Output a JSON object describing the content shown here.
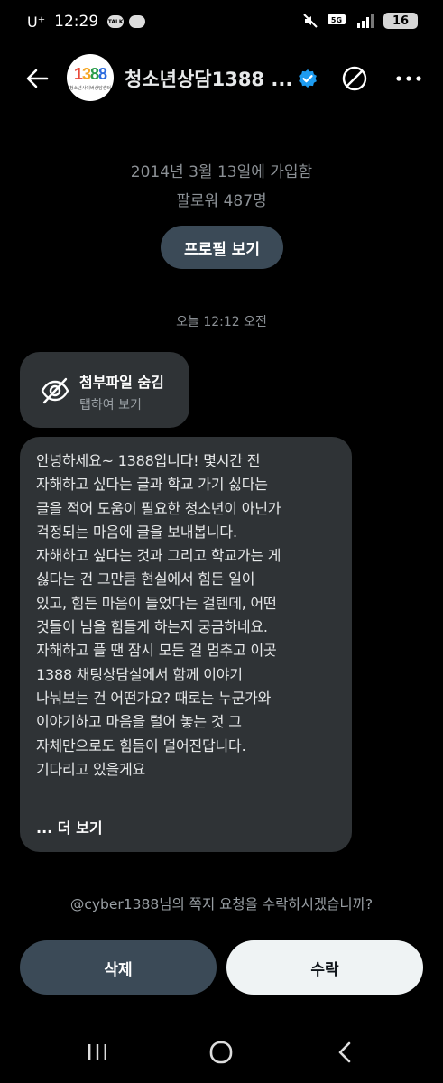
{
  "status_bar": {
    "carrier": "U⁺",
    "time": "12:29",
    "battery": "16"
  },
  "header": {
    "avatar_text": "1388",
    "avatar_subtext": "청소년사이버상담센터",
    "title": "청소년상담1388 ..."
  },
  "profile_info": {
    "joined": "2014년 3월 13일에 가입함",
    "followers": "팔로워 487명",
    "profile_button": "프로필 보기"
  },
  "conversation": {
    "timestamp": "오늘 12:12 오전",
    "attachment": {
      "title": "첨부파일 숨김",
      "subtitle": "탭하여 보기"
    },
    "message": {
      "text": "안녕하세요~ 1388입니다! 몇시간 전\n자해하고 싶다는 글과 학교 가기 싫다는\n글을 적어 도움이 필요한 청소년이 아닌가\n걱정되는 마음에 글을 보내봅니다.\n자해하고 싶다는 것과 그리고 학교가는 게\n싫다는 건 그만큼 현실에서 힘든 일이\n있고, 힘든 마음이 들었다는 걸텐데, 어떤\n것들이 님을 힘들게 하는지 궁금하네요.\n자해하고 플 땐 잠시 모든 걸 멈추고 이곳\n1388 채팅상담실에서 함께 이야기\n나눠보는 건 어떤가요?  때로는 누군가와\n이야기하고 마음을 털어 놓는 것 그\n자체만으로도 힘듬이 덜어진답니다.\n기다리고 있을게요",
      "more_label": "... 더 보기"
    }
  },
  "request": {
    "prompt": "@cyber1388님의 쪽지 요청을 수락하시겠습니까?",
    "delete_label": "삭제",
    "accept_label": "수락"
  },
  "colors": {
    "background": "#000000",
    "bubble": "#2f3336",
    "verified": "#1d9bf0",
    "secondary_button": "#3b4a57",
    "primary_button": "#eff3f4"
  }
}
